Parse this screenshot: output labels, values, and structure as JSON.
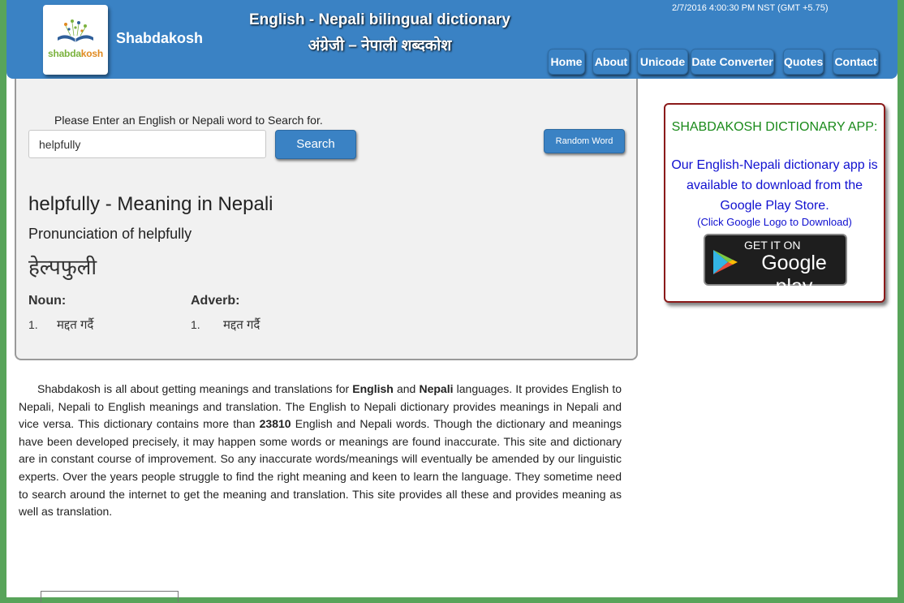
{
  "header": {
    "brand": "Shabdakosh",
    "logo_text_part1": "shabda",
    "logo_text_part2": "kosh",
    "title_en": "English - Nepali bilingual dictionary",
    "title_np": "अंग्रेजी – नेपाली शब्दकोश",
    "datetime": "2/7/2016 4:00:30 PM NST (GMT +5.75)"
  },
  "nav": [
    "Home",
    "About",
    "Unicode",
    "Date Converter",
    "Quotes",
    "Contact"
  ],
  "search": {
    "prompt": "Please Enter an English or Nepali word to Search for.",
    "value": "helpfully",
    "button": "Search",
    "random": "Random Word"
  },
  "result": {
    "title": "helpfully - Meaning in Nepali",
    "pron_label": "Pronunciation of helpfully",
    "pron_np": "हेल्पफुली",
    "sections": [
      {
        "pos": "Noun:",
        "num": "1.",
        "def": "मद्दत गर्दै"
      },
      {
        "pos": "Adverb:",
        "num": "1.",
        "def": "मद्दत गर्दै"
      }
    ]
  },
  "description": {
    "p1": "Shabdakosh is all about getting meanings and translations for ",
    "b1": "English",
    "p2": " and ",
    "b2": "Nepali",
    "p3": " languages. It provides English to Nepali, Nepali to English meanings and translation. The English to Nepali dictionary provides meanings in Nepali and vice versa. This dictionary contains more than ",
    "b3": "23810",
    "p4": " English and Nepali words. Though the dictionary and meanings have been developed precisely, it may happen some words or meanings are found inaccurate. This site and dictionary are in constant course of improvement. So any inaccurate words/meanings will eventually be amended by our linguistic experts. Over the years people struggle to find the right meaning and keen to learn the language. They sometime need to search around the internet to get the meaning and translation. This site provides all these and provides meaning as well as translation."
  },
  "ad": {
    "heading": "SHABDAKOSH DICTIONARY APP:",
    "body": "Our English-Nepali dictionary app is available to download from the Google Play Store.",
    "note": "(Click Google Logo to Download)",
    "badge_line1": "GET IT ON",
    "badge_line2": "Google play"
  },
  "colors": {
    "header_blue": "#3a82c4",
    "frame_green": "#58a45a",
    "ad_border": "#8b1a1a",
    "ad_heading": "#1a8a1a",
    "ad_text": "#1010d0"
  }
}
